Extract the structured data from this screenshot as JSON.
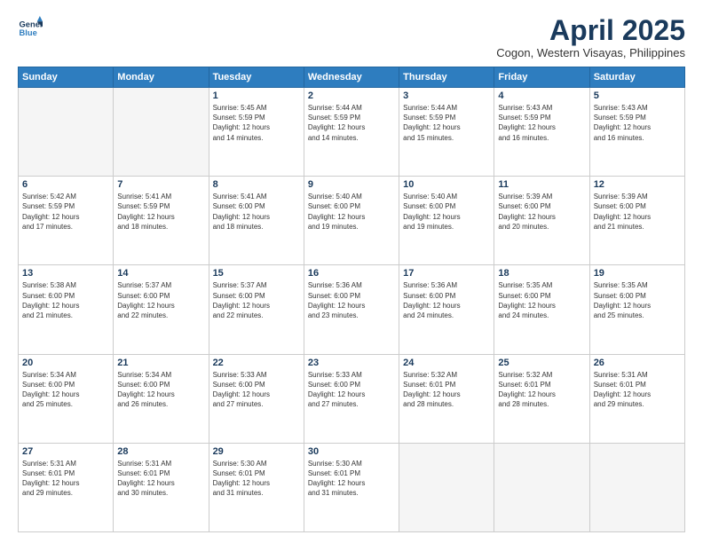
{
  "logo": {
    "line1": "General",
    "line2": "Blue"
  },
  "title": "April 2025",
  "subtitle": "Cogon, Western Visayas, Philippines",
  "weekdays": [
    "Sunday",
    "Monday",
    "Tuesday",
    "Wednesday",
    "Thursday",
    "Friday",
    "Saturday"
  ],
  "weeks": [
    [
      {
        "day": "",
        "info": ""
      },
      {
        "day": "",
        "info": ""
      },
      {
        "day": "1",
        "info": "Sunrise: 5:45 AM\nSunset: 5:59 PM\nDaylight: 12 hours\nand 14 minutes."
      },
      {
        "day": "2",
        "info": "Sunrise: 5:44 AM\nSunset: 5:59 PM\nDaylight: 12 hours\nand 14 minutes."
      },
      {
        "day": "3",
        "info": "Sunrise: 5:44 AM\nSunset: 5:59 PM\nDaylight: 12 hours\nand 15 minutes."
      },
      {
        "day": "4",
        "info": "Sunrise: 5:43 AM\nSunset: 5:59 PM\nDaylight: 12 hours\nand 16 minutes."
      },
      {
        "day": "5",
        "info": "Sunrise: 5:43 AM\nSunset: 5:59 PM\nDaylight: 12 hours\nand 16 minutes."
      }
    ],
    [
      {
        "day": "6",
        "info": "Sunrise: 5:42 AM\nSunset: 5:59 PM\nDaylight: 12 hours\nand 17 minutes."
      },
      {
        "day": "7",
        "info": "Sunrise: 5:41 AM\nSunset: 5:59 PM\nDaylight: 12 hours\nand 18 minutes."
      },
      {
        "day": "8",
        "info": "Sunrise: 5:41 AM\nSunset: 6:00 PM\nDaylight: 12 hours\nand 18 minutes."
      },
      {
        "day": "9",
        "info": "Sunrise: 5:40 AM\nSunset: 6:00 PM\nDaylight: 12 hours\nand 19 minutes."
      },
      {
        "day": "10",
        "info": "Sunrise: 5:40 AM\nSunset: 6:00 PM\nDaylight: 12 hours\nand 19 minutes."
      },
      {
        "day": "11",
        "info": "Sunrise: 5:39 AM\nSunset: 6:00 PM\nDaylight: 12 hours\nand 20 minutes."
      },
      {
        "day": "12",
        "info": "Sunrise: 5:39 AM\nSunset: 6:00 PM\nDaylight: 12 hours\nand 21 minutes."
      }
    ],
    [
      {
        "day": "13",
        "info": "Sunrise: 5:38 AM\nSunset: 6:00 PM\nDaylight: 12 hours\nand 21 minutes."
      },
      {
        "day": "14",
        "info": "Sunrise: 5:37 AM\nSunset: 6:00 PM\nDaylight: 12 hours\nand 22 minutes."
      },
      {
        "day": "15",
        "info": "Sunrise: 5:37 AM\nSunset: 6:00 PM\nDaylight: 12 hours\nand 22 minutes."
      },
      {
        "day": "16",
        "info": "Sunrise: 5:36 AM\nSunset: 6:00 PM\nDaylight: 12 hours\nand 23 minutes."
      },
      {
        "day": "17",
        "info": "Sunrise: 5:36 AM\nSunset: 6:00 PM\nDaylight: 12 hours\nand 24 minutes."
      },
      {
        "day": "18",
        "info": "Sunrise: 5:35 AM\nSunset: 6:00 PM\nDaylight: 12 hours\nand 24 minutes."
      },
      {
        "day": "19",
        "info": "Sunrise: 5:35 AM\nSunset: 6:00 PM\nDaylight: 12 hours\nand 25 minutes."
      }
    ],
    [
      {
        "day": "20",
        "info": "Sunrise: 5:34 AM\nSunset: 6:00 PM\nDaylight: 12 hours\nand 25 minutes."
      },
      {
        "day": "21",
        "info": "Sunrise: 5:34 AM\nSunset: 6:00 PM\nDaylight: 12 hours\nand 26 minutes."
      },
      {
        "day": "22",
        "info": "Sunrise: 5:33 AM\nSunset: 6:00 PM\nDaylight: 12 hours\nand 27 minutes."
      },
      {
        "day": "23",
        "info": "Sunrise: 5:33 AM\nSunset: 6:00 PM\nDaylight: 12 hours\nand 27 minutes."
      },
      {
        "day": "24",
        "info": "Sunrise: 5:32 AM\nSunset: 6:01 PM\nDaylight: 12 hours\nand 28 minutes."
      },
      {
        "day": "25",
        "info": "Sunrise: 5:32 AM\nSunset: 6:01 PM\nDaylight: 12 hours\nand 28 minutes."
      },
      {
        "day": "26",
        "info": "Sunrise: 5:31 AM\nSunset: 6:01 PM\nDaylight: 12 hours\nand 29 minutes."
      }
    ],
    [
      {
        "day": "27",
        "info": "Sunrise: 5:31 AM\nSunset: 6:01 PM\nDaylight: 12 hours\nand 29 minutes."
      },
      {
        "day": "28",
        "info": "Sunrise: 5:31 AM\nSunset: 6:01 PM\nDaylight: 12 hours\nand 30 minutes."
      },
      {
        "day": "29",
        "info": "Sunrise: 5:30 AM\nSunset: 6:01 PM\nDaylight: 12 hours\nand 31 minutes."
      },
      {
        "day": "30",
        "info": "Sunrise: 5:30 AM\nSunset: 6:01 PM\nDaylight: 12 hours\nand 31 minutes."
      },
      {
        "day": "",
        "info": ""
      },
      {
        "day": "",
        "info": ""
      },
      {
        "day": "",
        "info": ""
      }
    ]
  ]
}
